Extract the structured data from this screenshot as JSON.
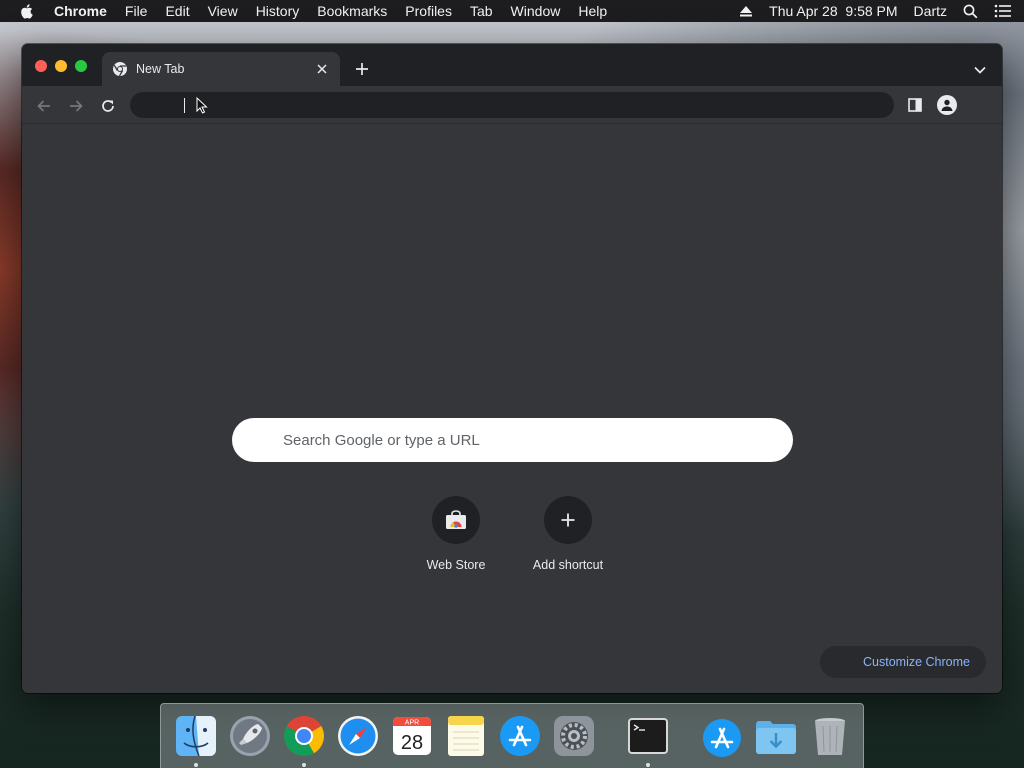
{
  "menubar": {
    "app_name": "Chrome",
    "items": [
      "File",
      "Edit",
      "View",
      "History",
      "Bookmarks",
      "Profiles",
      "Tab",
      "Window",
      "Help"
    ],
    "datetime": "Thu Apr 28  9:58 PM",
    "user": "Dartz"
  },
  "window": {
    "tab_title": "New Tab",
    "omnibox_value": ""
  },
  "ntp": {
    "search_placeholder": "Search Google or type a URL",
    "shortcuts": [
      {
        "label": "Web Store",
        "icon": "web-store-icon"
      },
      {
        "label": "Add shortcut",
        "icon": "plus-icon"
      }
    ],
    "customize_label": "Customize Chrome"
  },
  "dock": {
    "items": [
      "Finder",
      "Launchpad",
      "Google Chrome",
      "Safari",
      "Calendar",
      "Notes",
      "App Store",
      "System Preferences",
      "Terminal",
      "Applications",
      "Downloads",
      "Trash"
    ],
    "calendar_month": "APR",
    "calendar_day": "28"
  },
  "colors": {
    "tab_strip": "#202124",
    "toolbar": "#35363a",
    "accent_link": "#8ab4f8"
  }
}
